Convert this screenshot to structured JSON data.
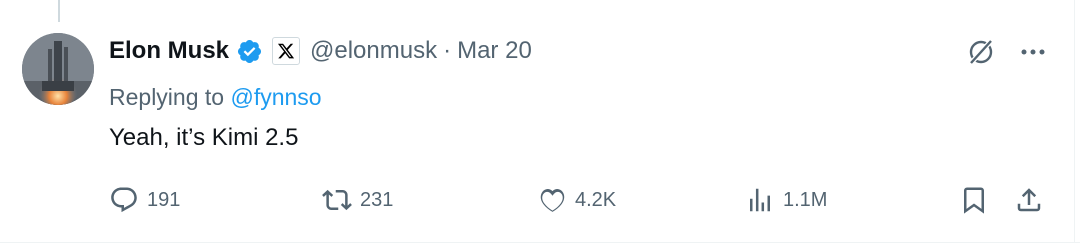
{
  "tweet": {
    "author_name": "Elon Musk",
    "handle": "@elonmusk",
    "separator": "·",
    "date": "Mar 20",
    "replying_prefix": "Replying to",
    "replying_to": "@fynnso",
    "text": "Yeah, it’s Kimi 2.5"
  },
  "actions": {
    "replies": "191",
    "reposts": "231",
    "likes": "4.2K",
    "views": "1.1M"
  },
  "icons": {
    "verified": "verified-badge-icon",
    "affiliation": "x-logo-icon",
    "grok": "grok-icon",
    "more": "more-icon",
    "reply": "reply-icon",
    "repost": "repost-icon",
    "like": "heart-icon",
    "views": "views-icon",
    "bookmark": "bookmark-icon",
    "share": "share-icon"
  },
  "colors": {
    "text": "#0f1419",
    "secondary": "#536471",
    "accent": "#1d9bf0"
  }
}
